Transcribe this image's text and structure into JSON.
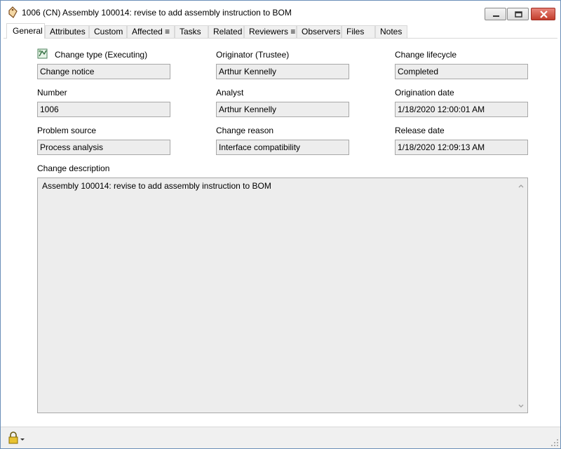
{
  "window": {
    "title": "1006 (CN) Assembly 100014: revise to add assembly instruction to BOM"
  },
  "tabs": [
    {
      "label": "General"
    },
    {
      "label": "Attributes"
    },
    {
      "label": "Custom"
    },
    {
      "label": "Affected ≡"
    },
    {
      "label": "Tasks"
    },
    {
      "label": "Related"
    },
    {
      "label": "Reviewers ≡"
    },
    {
      "label": "Observers"
    },
    {
      "label": "Files"
    },
    {
      "label": "Notes"
    }
  ],
  "fields": {
    "change_type": {
      "label": "Change type (Executing)",
      "value": "Change notice"
    },
    "originator": {
      "label": "Originator (Trustee)",
      "value": "Arthur Kennelly"
    },
    "change_lifecycle": {
      "label": "Change lifecycle",
      "value": "Completed"
    },
    "number": {
      "label": "Number",
      "value": "1006"
    },
    "analyst": {
      "label": "Analyst",
      "value": "Arthur Kennelly"
    },
    "origination_date": {
      "label": "Origination date",
      "value": "1/18/2020 12:00:01 AM"
    },
    "problem_source": {
      "label": "Problem source",
      "value": "Process analysis"
    },
    "change_reason": {
      "label": "Change reason",
      "value": "Interface compatibility"
    },
    "release_date": {
      "label": "Release date",
      "value": "1/18/2020 12:09:13 AM"
    },
    "change_description": {
      "label": "Change description",
      "value": "Assembly 100014: revise to add assembly instruction to BOM"
    }
  },
  "icons": {
    "title": "change-tag-icon",
    "change_type": "change-type-icon",
    "lock": "padlock-icon"
  },
  "colors": {
    "window_border": "#6b8fb8",
    "field_bg": "#ededed",
    "close_button": "#c23d2c"
  }
}
